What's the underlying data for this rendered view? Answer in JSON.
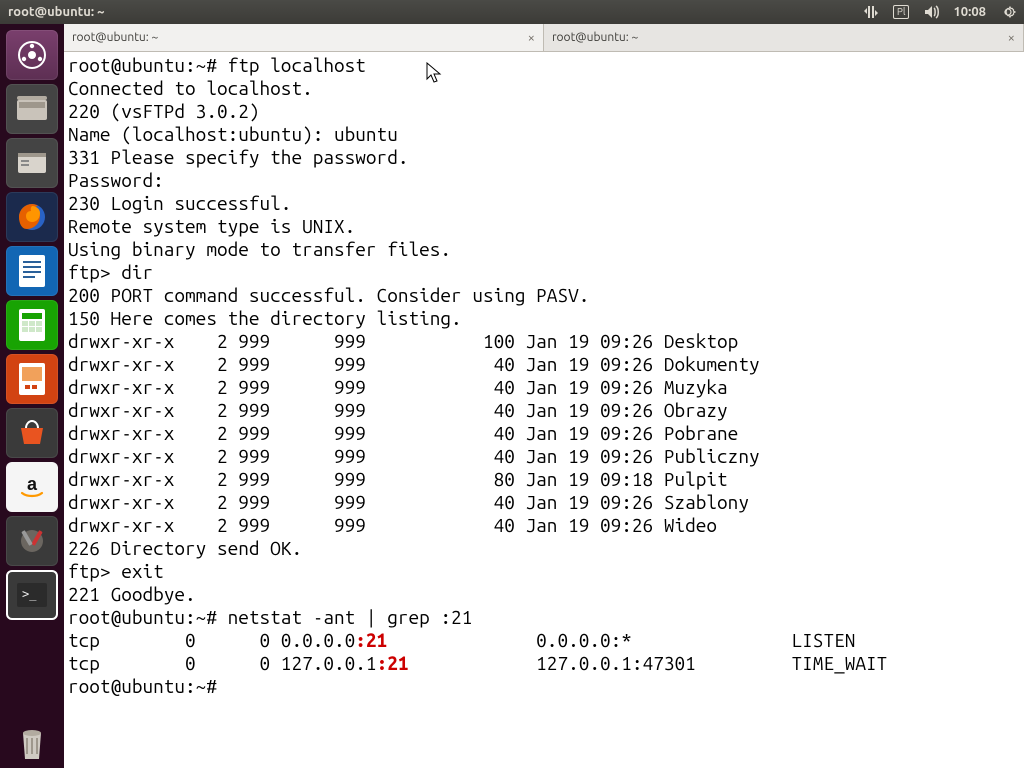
{
  "menubar": {
    "title": "root@ubuntu: ~",
    "keyboard_indicator": "Pl",
    "clock": "10:08"
  },
  "tabs": [
    {
      "title": "root@ubuntu: ~",
      "active": true
    },
    {
      "title": "root@ubuntu: ~",
      "active": false
    }
  ],
  "terminal": {
    "prompt1": "root@ubuntu:~# ",
    "cmd1": "ftp localhost",
    "line_connected": "Connected to localhost.",
    "line_banner": "220 (vsFTPd 3.0.2)",
    "line_name": "Name (localhost:ubuntu): ubuntu",
    "line_331": "331 Please specify the password.",
    "line_password": "Password:",
    "line_230": "230 Login successful.",
    "line_systype": "Remote system type is UNIX.",
    "line_binmode": "Using binary mode to transfer files.",
    "ftp_prompt1": "ftp> ",
    "ftp_cmd1": "dir",
    "line_200": "200 PORT command successful. Consider using PASV.",
    "line_150": "150 Here comes the directory listing.",
    "dir_rows": [
      "drwxr-xr-x    2 999      999           100 Jan 19 09:26 Desktop",
      "drwxr-xr-x    2 999      999            40 Jan 19 09:26 Dokumenty",
      "drwxr-xr-x    2 999      999            40 Jan 19 09:26 Muzyka",
      "drwxr-xr-x    2 999      999            40 Jan 19 09:26 Obrazy",
      "drwxr-xr-x    2 999      999            40 Jan 19 09:26 Pobrane",
      "drwxr-xr-x    2 999      999            40 Jan 19 09:26 Publiczny",
      "drwxr-xr-x    2 999      999            80 Jan 19 09:18 Pulpit",
      "drwxr-xr-x    2 999      999            40 Jan 19 09:26 Szablony",
      "drwxr-xr-x    2 999      999            40 Jan 19 09:26 Wideo"
    ],
    "line_226": "226 Directory send OK.",
    "ftp_prompt2": "ftp> ",
    "ftp_cmd2": "exit",
    "line_221": "221 Goodbye.",
    "prompt2": "root@ubuntu:~# ",
    "cmd2": "netstat -ant | grep :21",
    "netstat_row1_pre": "tcp        0      0 0.0.0.0",
    "netstat_row1_hl": ":21",
    "netstat_row1_post": "              0.0.0.0:*               LISTEN     ",
    "netstat_row2_pre": "tcp        0      0 127.0.0.1",
    "netstat_row2_hl": ":21",
    "netstat_row2_post": "            127.0.0.1:47301         TIME_WAIT  ",
    "prompt3": "root@ubuntu:~# "
  }
}
